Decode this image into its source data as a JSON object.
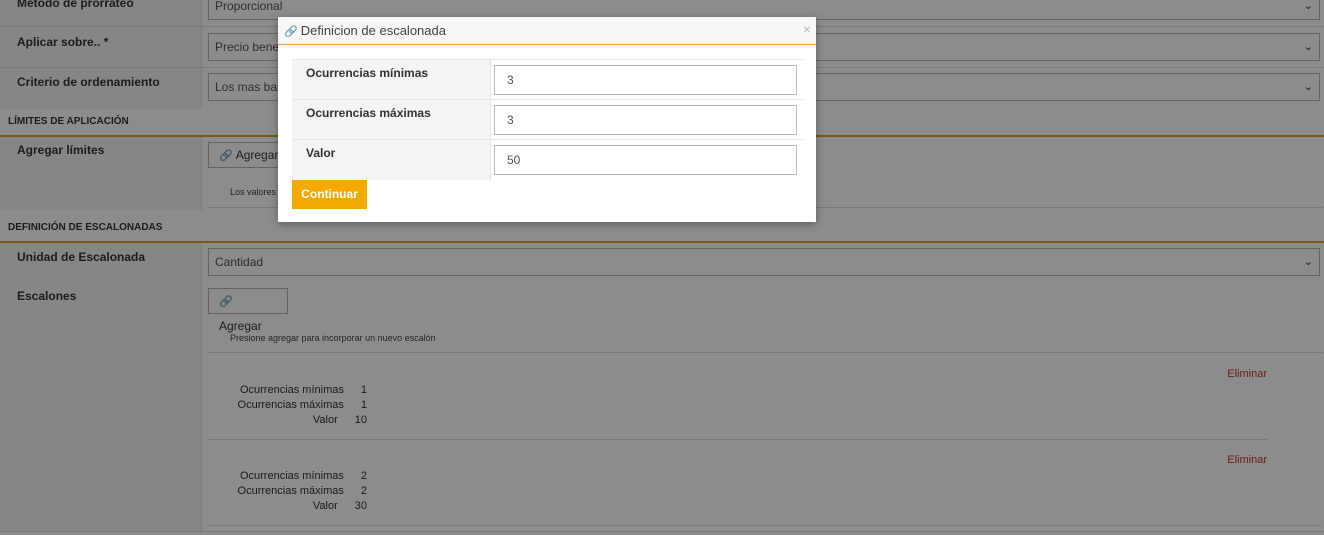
{
  "form": {
    "row_prorrateo": {
      "label": "Método de prorrateo",
      "value": "Proporcional"
    },
    "row_aplicar": {
      "label": "Aplicar sobre.. *",
      "value": "Precio benef"
    },
    "row_criterio": {
      "label": "Criterio de ordenamiento",
      "value": "Los mas bar"
    },
    "section_limites": "LÍMITES DE APLICACIÓN",
    "row_limites": {
      "label": "Agregar límites",
      "button": "Agregar",
      "hint": "Los valores"
    },
    "section_escalonadas": "DEFINICIÓN DE ESCALONADAS",
    "row_unidad": {
      "label": "Unidad de Escalonada",
      "value": "Cantidad"
    },
    "row_escalones": {
      "label": "Escalones",
      "button": "Agregar",
      "hint": "Presione agregar para incorporar un nuevo escalón"
    },
    "escalones": [
      {
        "min_label": "Ocurrencias mínimas",
        "min": "1",
        "max_label": "Ocurrencias máximas",
        "max": "1",
        "valor_label": "Valor",
        "valor": "10",
        "delete": "Eliminar"
      },
      {
        "min_label": "Ocurrencias mínimas",
        "min": "2",
        "max_label": "Ocurrencias máximas",
        "max": "2",
        "valor_label": "Valor",
        "valor": "30",
        "delete": "Eliminar"
      }
    ]
  },
  "modal": {
    "title": "Definicion de escalonada",
    "close": "×",
    "fields": [
      {
        "label": "Ocurrencias mínimas",
        "value": "3"
      },
      {
        "label": "Ocurrencias máximas",
        "value": "3"
      },
      {
        "label": "Valor",
        "value": "50"
      }
    ],
    "continue_label": "Continuar"
  },
  "icons": {
    "link": "link-icon",
    "chevron": "chevron-down-icon",
    "close": "close-icon"
  },
  "colors": {
    "accent": "#f2a900",
    "section_border": "#e0a623",
    "delete": "#c0392b"
  }
}
